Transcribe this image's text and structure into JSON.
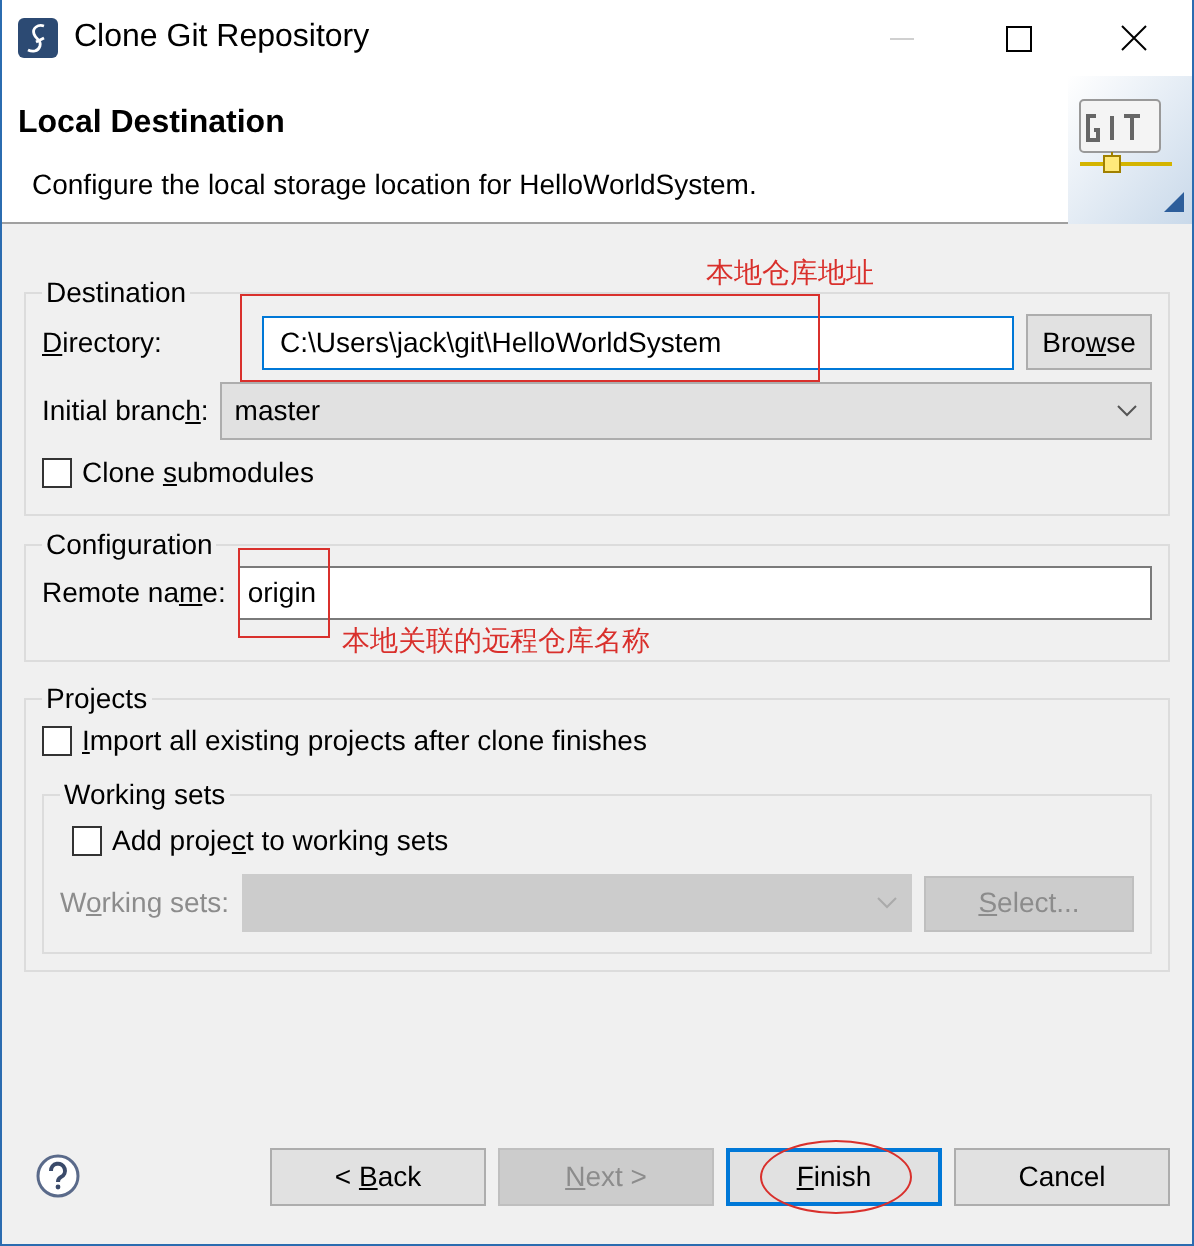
{
  "window": {
    "title": "Clone Git Repository"
  },
  "header": {
    "title": "Local Destination",
    "description": "Configure the local storage location for HelloWorldSystem."
  },
  "destination": {
    "title": "Destination",
    "directory": {
      "label": {
        "key": "D",
        "post": "irectory:"
      },
      "value": "C:\\Users\\jack\\git\\HelloWorldSystem",
      "focused": true
    },
    "browse_button": {
      "pre": "Bro",
      "key": "w",
      "post": "se"
    },
    "initial_branch": {
      "label": {
        "pre": "Initial branc",
        "key": "h",
        "post": ":"
      },
      "value": "master"
    },
    "clone_submodules": {
      "label": {
        "pre": "Clone ",
        "key": "s",
        "post": "ubmodules"
      },
      "checked": false
    }
  },
  "configuration": {
    "title": "Configuration",
    "remote_name": {
      "label": {
        "pre": "Remote na",
        "key": "m",
        "post": "e:"
      },
      "value": "origin"
    }
  },
  "projects": {
    "title": "Projects",
    "import_all": {
      "label": {
        "key": "I",
        "post": "mport all existing projects after clone finishes"
      },
      "checked": false
    },
    "working_sets": {
      "title": "Working sets",
      "add_project": {
        "label": {
          "pre": "Add proje",
          "key": "c",
          "post": "t to working sets"
        },
        "checked": false
      },
      "working_sets_field": {
        "label": {
          "pre": "W",
          "key": "o",
          "post": "rking sets:"
        },
        "disabled": true
      },
      "select_button": {
        "label": {
          "key": "S",
          "post": "elect..."
        },
        "disabled": true
      }
    }
  },
  "buttons": [
    {
      "label": {
        "pre": "< ",
        "key": "B",
        "post": "ack"
      },
      "disabled": false,
      "default": false
    },
    {
      "label": {
        "key": "N",
        "post": "ext >"
      },
      "disabled": true,
      "default": false
    },
    {
      "label": {
        "key": "F",
        "post": "inish"
      },
      "disabled": false,
      "default": true
    },
    {
      "label": {
        "post": "Cancel"
      },
      "disabled": false,
      "default": false
    }
  ],
  "annotations": [
    {
      "text": "本地仓库地址"
    },
    {
      "text": "本地关联的远程仓库名称"
    }
  ]
}
